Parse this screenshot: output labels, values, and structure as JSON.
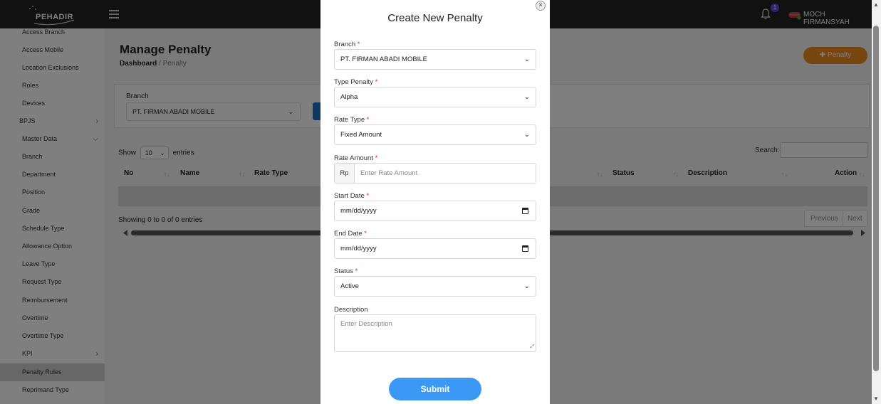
{
  "header": {
    "logo_text": "PEHADIR",
    "notification_count": "1",
    "user_name": "MOCH FIRMANSYAH"
  },
  "sidebar": {
    "items": [
      {
        "label": "Access Branch"
      },
      {
        "label": "Access Mobile"
      },
      {
        "label": "Location Exclusions"
      },
      {
        "label": "Roles"
      },
      {
        "label": "Devices"
      },
      {
        "label": "BPJS"
      },
      {
        "label": "Master Data"
      },
      {
        "label": "Branch"
      },
      {
        "label": "Department"
      },
      {
        "label": "Position"
      },
      {
        "label": "Grade"
      },
      {
        "label": "Schedule Type"
      },
      {
        "label": "Allowance Option"
      },
      {
        "label": "Leave Type"
      },
      {
        "label": "Request Type"
      },
      {
        "label": "Reimbursement"
      },
      {
        "label": "Overtime"
      },
      {
        "label": "Overtime Type"
      },
      {
        "label": "KPI"
      },
      {
        "label": "Penalty Rules"
      },
      {
        "label": "Reprimand Type"
      }
    ]
  },
  "page": {
    "title": "Manage Penalty",
    "breadcrumb_home": "Dashboard",
    "breadcrumb_sep": "/",
    "breadcrumb_current": "Penalty",
    "add_button": "Penalty"
  },
  "filter": {
    "branch_label": "Branch",
    "branch_value": "PT. FIRMAN ABADI MOBILE"
  },
  "table": {
    "show_label": "Show",
    "page_size": "10",
    "entries_label": "entries",
    "search_label": "Search:",
    "columns": [
      "No",
      "Name",
      "Rate Type",
      "Status",
      "Description",
      "Action"
    ],
    "info": "Showing 0 to 0 of 0 entries",
    "prev": "Previous",
    "next": "Next"
  },
  "modal": {
    "title": "Create New Penalty",
    "required_mark": "*",
    "branch_label": "Branch",
    "branch_value": "PT. FIRMAN ABADI MOBILE",
    "type_label": "Type Penalty",
    "type_value": "Alpha",
    "rate_type_label": "Rate Type",
    "rate_type_value": "Fixed Amount",
    "rate_amount_label": "Rate Amount",
    "rate_prefix": "Rp",
    "rate_amount_placeholder": "Enter Rate Amount",
    "start_date_label": "Start Date",
    "start_date_value": "mm/dd/yyyy",
    "end_date_label": "End Date",
    "end_date_value": "mm/dd/yyyy",
    "status_label": "Status",
    "status_value": "Active",
    "description_label": "Description",
    "description_placeholder": "Enter Description",
    "submit": "Submit"
  }
}
